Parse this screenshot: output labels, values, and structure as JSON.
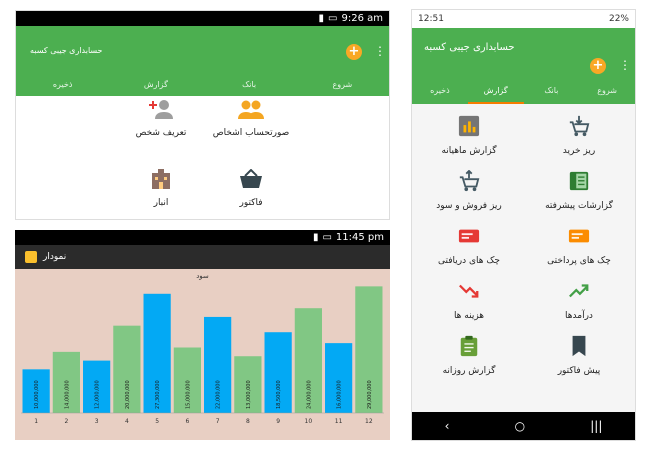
{
  "panel1": {
    "status_time": "9:26 am",
    "title": "حسابداری جیبی کسبه",
    "tabs": [
      "شروع",
      "بانک",
      "گزارش",
      "ذخیره"
    ],
    "active_tab": 0,
    "items": [
      {
        "label": "صورتحساب اشخاص",
        "icon": "people-icon"
      },
      {
        "label": "تعریف شخص",
        "icon": "add-person-icon"
      },
      {
        "label": "فاکتور",
        "icon": "basket-icon"
      },
      {
        "label": "انبار",
        "icon": "warehouse-icon"
      }
    ]
  },
  "panel2": {
    "status_time": "11:45 pm",
    "header_title": "نمودار"
  },
  "chart_data": {
    "type": "bar",
    "title": "سود",
    "categories": [
      "1",
      "2",
      "3",
      "4",
      "5",
      "6",
      "7",
      "8",
      "9",
      "10",
      "11",
      "12"
    ],
    "values": [
      10000000,
      14000000,
      12000000,
      20000000,
      27300000,
      15000000,
      22000000,
      13000000,
      18500000,
      24000000,
      16000000,
      29000000
    ],
    "labels": [
      "10,000,000",
      "14,000,000",
      "12,000,000",
      "20,000,000",
      "27,300,000",
      "15,000,000",
      "22,000,000",
      "13,000,000",
      "18,500,000",
      "24,000,000",
      "16,000,000",
      "29,000,000"
    ],
    "colors": [
      "#03a9f4",
      "#81c784",
      "#03a9f4",
      "#81c784",
      "#03a9f4",
      "#81c784",
      "#03a9f4",
      "#81c784",
      "#03a9f4",
      "#81c784",
      "#03a9f4",
      "#81c784"
    ],
    "ylim": [
      0,
      30000000
    ]
  },
  "panel3": {
    "status_time": "12:51",
    "battery": "22%",
    "title": "حسابداری جیبی کسبه",
    "tabs": [
      "شروع",
      "بانک",
      "گزارش",
      "ذخیره"
    ],
    "active_tab": 2,
    "items": [
      {
        "label": "ریز خرید",
        "icon": "cart-down-icon"
      },
      {
        "label": "گزارش ماهیانه",
        "icon": "bar-report-icon"
      },
      {
        "label": "گزارشات پیشرفته",
        "icon": "book-icon"
      },
      {
        "label": "ریز فروش و سود",
        "icon": "cart-up-icon"
      },
      {
        "label": "چک های پرداختی",
        "icon": "cheque-orange-icon"
      },
      {
        "label": "چک های دریافتی",
        "icon": "cheque-red-icon"
      },
      {
        "label": "درآمدها",
        "icon": "trend-up-icon"
      },
      {
        "label": "هزینه ها",
        "icon": "trend-down-icon"
      },
      {
        "label": "پیش فاکتور",
        "icon": "bookmark-icon"
      },
      {
        "label": "گزارش روزانه",
        "icon": "clipboard-icon"
      }
    ]
  }
}
